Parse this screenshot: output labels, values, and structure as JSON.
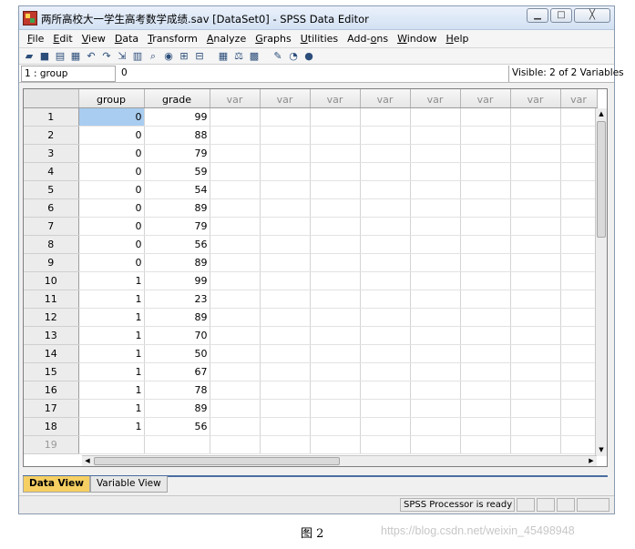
{
  "window": {
    "title": "两所高校大一学生高考数学成绩.sav [DataSet0] - SPSS Data Editor",
    "min_label": "▁",
    "max_label": "□",
    "close_label": "╳"
  },
  "menu": [
    "File",
    "Edit",
    "View",
    "Data",
    "Transform",
    "Analyze",
    "Graphs",
    "Utilities",
    "Add-ons",
    "Window",
    "Help"
  ],
  "toolbar_icons": [
    "open-icon",
    "save-icon",
    "print-icon",
    "dialog-recall-icon",
    "undo-icon",
    "redo-icon",
    "goto-case-icon",
    "variables-icon",
    "find-icon",
    "insert-cases-icon",
    "insert-variable-icon",
    "split-file-icon",
    "weight-cases-icon",
    "select-cases-icon",
    "value-labels-icon",
    "use-sets-icon",
    "show-all-icon"
  ],
  "cellbar": {
    "ref": "1 : group",
    "value": "0",
    "visible": "Visible: 2 of 2 Variables"
  },
  "columns": [
    "group",
    "grade",
    "var",
    "var",
    "var",
    "var",
    "var",
    "var",
    "var",
    "var"
  ],
  "rows": [
    {
      "n": "1",
      "group": "0",
      "grade": "99"
    },
    {
      "n": "2",
      "group": "0",
      "grade": "88"
    },
    {
      "n": "3",
      "group": "0",
      "grade": "79"
    },
    {
      "n": "4",
      "group": "0",
      "grade": "59"
    },
    {
      "n": "5",
      "group": "0",
      "grade": "54"
    },
    {
      "n": "6",
      "group": "0",
      "grade": "89"
    },
    {
      "n": "7",
      "group": "0",
      "grade": "79"
    },
    {
      "n": "8",
      "group": "0",
      "grade": "56"
    },
    {
      "n": "9",
      "group": "0",
      "grade": "89"
    },
    {
      "n": "10",
      "group": "1",
      "grade": "99"
    },
    {
      "n": "11",
      "group": "1",
      "grade": "23"
    },
    {
      "n": "12",
      "group": "1",
      "grade": "89"
    },
    {
      "n": "13",
      "group": "1",
      "grade": "70"
    },
    {
      "n": "14",
      "group": "1",
      "grade": "50"
    },
    {
      "n": "15",
      "group": "1",
      "grade": "67"
    },
    {
      "n": "16",
      "group": "1",
      "grade": "78"
    },
    {
      "n": "17",
      "group": "1",
      "grade": "89"
    },
    {
      "n": "18",
      "group": "1",
      "grade": "56"
    },
    {
      "n": "19",
      "group": "",
      "grade": ""
    }
  ],
  "tabs": [
    "Data View",
    "Variable View"
  ],
  "status": "SPSS  Processor is ready",
  "caption": "图 2",
  "watermark": "https://blog.csdn.net/weixin_45498948"
}
